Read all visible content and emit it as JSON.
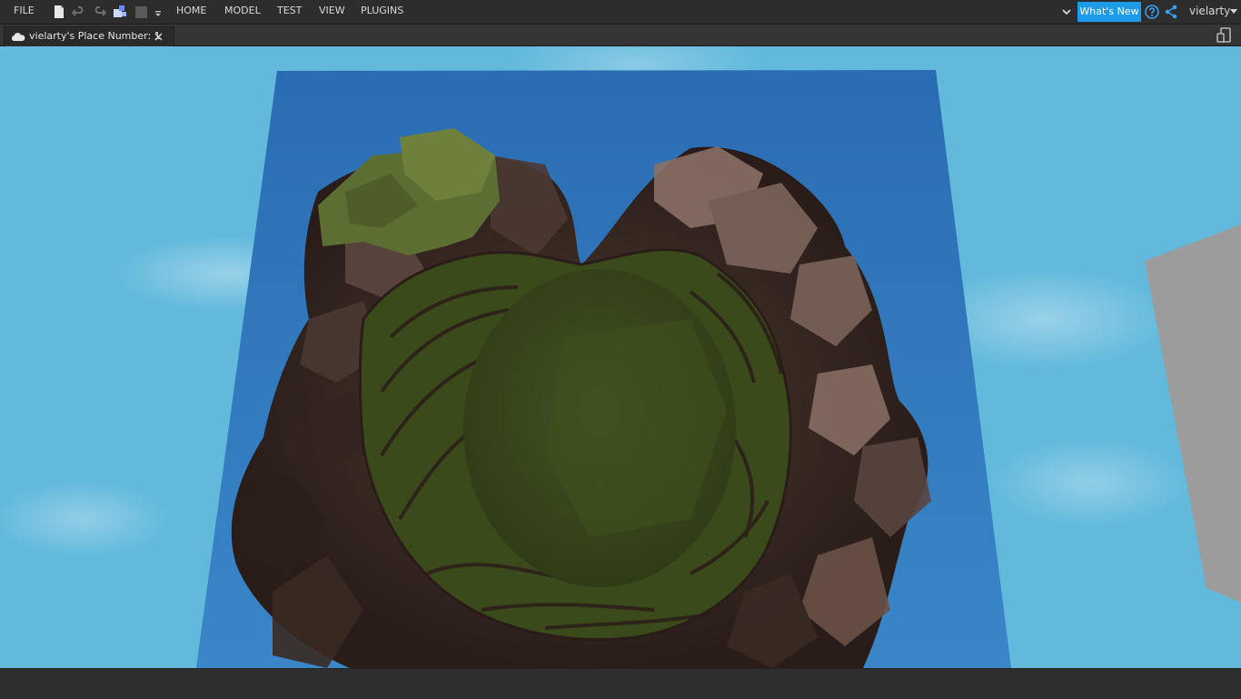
{
  "menu": {
    "file": "FILE",
    "tabs": [
      "HOME",
      "MODEL",
      "TEST",
      "VIEW",
      "PLUGINS"
    ]
  },
  "quick_access": [
    {
      "icon": "new-file-icon"
    },
    {
      "icon": "undo-icon"
    },
    {
      "icon": "redo-icon"
    },
    {
      "icon": "plugin-icon"
    },
    {
      "icon": "stop-icon"
    },
    {
      "icon": "customize-dropdown-icon"
    }
  ],
  "right": {
    "whats_new": "What's New",
    "user": "vielarty"
  },
  "document_tab": {
    "title": "vielarty's Place Number: 1"
  },
  "colors": {
    "accent": "#1e9bea",
    "sky": "#62b9dc",
    "baseplate": "#2f74b8",
    "grass": "#3d4a1c",
    "rock": "#6b5248"
  }
}
